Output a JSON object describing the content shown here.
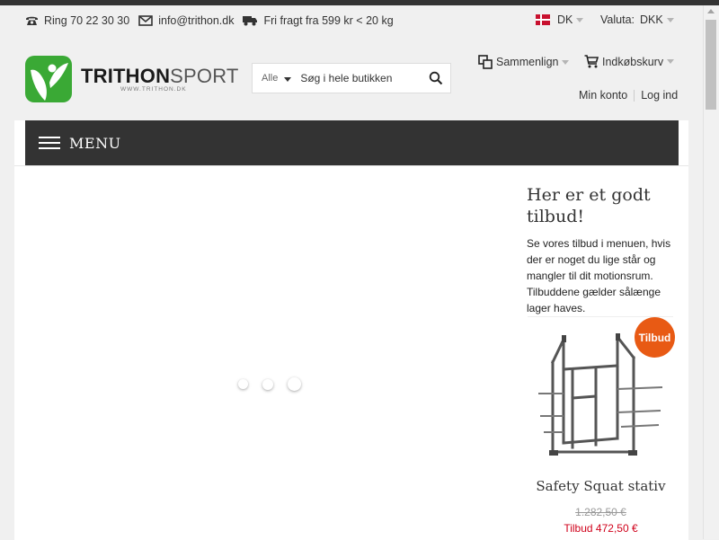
{
  "header": {
    "phone": "Ring 70 22 30 30",
    "email": "info@trithon.dk",
    "shipping": "Fri fragt fra 599 kr < 20 kg",
    "language": "DK",
    "currency_label": "Valuta:",
    "currency_value": "DKK"
  },
  "logo": {
    "brand_bold": "TRITHON",
    "brand_thin": "SPORT",
    "url_text": "WWW.TRITHON.DK"
  },
  "search": {
    "category": "Alle",
    "placeholder": "Søg i hele butikken"
  },
  "toolbar": {
    "compare_label": "Sammenlign",
    "cart_label": "Indkøbskurv",
    "account_label": "Min konto",
    "login_label": "Log ind"
  },
  "nav": {
    "menu_label": "MENU"
  },
  "offer": {
    "title": "Her er et godt tilbud!",
    "text": "Se vores tilbud i menuen, hvis der er noget du lige står og mangler til dit motionsrum. Tilbuddene gælder sålænge lager haves.",
    "product": {
      "badge": "Tilbud",
      "name": "Safety Squat stativ",
      "old_price": "1.282,50 €",
      "new_price": "Tilbud 472,50 €"
    }
  },
  "colors": {
    "menu_bar": "#333333",
    "brand_green": "#3aa935",
    "badge_orange": "#e85a14",
    "sale_red": "#d0021b"
  },
  "icons": {
    "phone": "phone-icon",
    "email": "envelope-icon",
    "shipping": "truck-icon",
    "search": "search-icon",
    "compare": "compare-icon",
    "cart": "cart-icon",
    "menu": "hamburger-icon"
  }
}
